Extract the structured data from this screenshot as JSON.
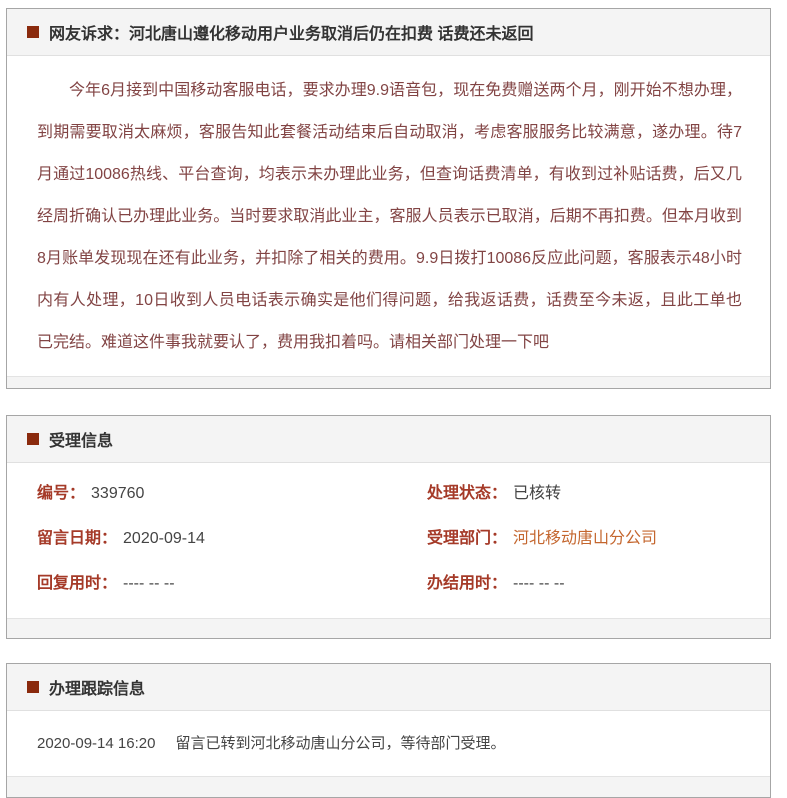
{
  "colors": {
    "bullet": "#8a2a0d",
    "section_header_bg": "#f4f4f4",
    "box_border": "#a6a6a6",
    "label_red": "#a53a28",
    "complaint_text": "#824444",
    "department_link_orange": "#c4662e",
    "value_gray": "#444444"
  },
  "sections": {
    "complaint": {
      "title": "网友诉求：河北唐山遵化移动用户业务取消后仍在扣费 话费还未返回",
      "body": "今年6月接到中国移动客服电话，要求办理9.9语音包，现在免费赠送两个月，刚开始不想办理，到期需要取消太麻烦，客服告知此套餐活动结束后自动取消，考虑客服服务比较满意，遂办理。待7月通过10086热线、平台查询，均表示未办理此业务，但查询话费清单，有收到过补贴话费，后又几经周折确认已办理此业务。当时要求取消此业主，客服人员表示已取消，后期不再扣费。但本月收到8月账单发现现在还有此业务，并扣除了相关的费用。9.9日拨打10086反应此问题，客服表示48小时内有人处理，10日收到人员电话表示确实是他们得问题，给我返话费，话费至今未返，且此工单也已完结。难道这件事我就要认了，费用我扣着吗。请相关部门处理一下吧"
    },
    "acceptance": {
      "title": "受理信息",
      "fields": [
        {
          "label": "编号：",
          "value": "339760"
        },
        {
          "label": "处理状态：",
          "value": "已核转"
        },
        {
          "label": "留言日期：",
          "value": "2020-09-14"
        },
        {
          "label": "受理部门：",
          "value": "河北移动唐山分公司",
          "highlight": true
        },
        {
          "label": "回复用时：",
          "value": "---- -- --"
        },
        {
          "label": "办结用时：",
          "value": "---- -- --"
        }
      ]
    },
    "tracking": {
      "title": "办理跟踪信息",
      "entries": [
        {
          "time": "2020-09-14 16:20",
          "message": "留言已转到河北移动唐山分公司，等待部门受理。"
        }
      ]
    }
  }
}
